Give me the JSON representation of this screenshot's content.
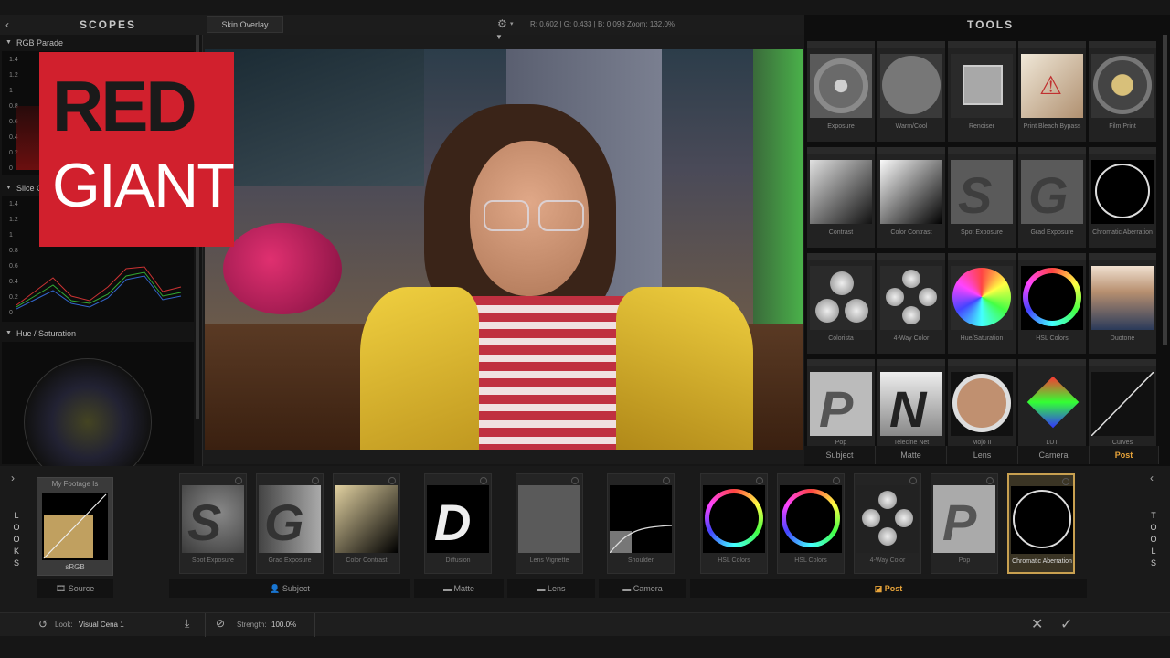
{
  "scopes": {
    "title": "SCOPES",
    "sections": [
      {
        "label": "RGB Parade"
      },
      {
        "label": "Slice Graph"
      },
      {
        "label": "Hue / Saturation"
      }
    ],
    "ticks": [
      "1.4",
      "1.2",
      "1",
      "0.8",
      "0.6",
      "0.4",
      "0.2",
      "0"
    ]
  },
  "logo": {
    "line1": "RED",
    "line2": "GIANT"
  },
  "viewer": {
    "skin_overlay": "Skin Overlay",
    "readout": "R: 0.602 | G: 0.433 | B: 0.098    Zoom: 132.0%"
  },
  "tools": {
    "title": "TOOLS",
    "items": [
      {
        "label": "Exposure"
      },
      {
        "label": "Warm/Cool"
      },
      {
        "label": "Renoiser"
      },
      {
        "label": "Print Bleach Bypass"
      },
      {
        "label": "Film Print"
      },
      {
        "label": "Contrast"
      },
      {
        "label": "Color Contrast"
      },
      {
        "label": "Spot Exposure"
      },
      {
        "label": "Grad Exposure"
      },
      {
        "label": "Chromatic Aberration"
      },
      {
        "label": "Colorista"
      },
      {
        "label": "4-Way Color"
      },
      {
        "label": "Hue/Saturation"
      },
      {
        "label": "HSL Colors"
      },
      {
        "label": "Duotone"
      },
      {
        "label": "Pop"
      },
      {
        "label": "Telecine Net"
      },
      {
        "label": "Mojo II"
      },
      {
        "label": "LUT"
      },
      {
        "label": "Curves"
      }
    ],
    "tabs": [
      "Subject",
      "Matte",
      "Lens",
      "Camera",
      "Post"
    ],
    "active_tab": "Post",
    "accent": "#e8a43a"
  },
  "looks": {
    "side_label": "LOOKS",
    "source": {
      "title": "My Footage Is",
      "value": "sRGB",
      "label": "Source"
    },
    "cards": [
      {
        "label": "Spot Exposure"
      },
      {
        "label": "Grad Exposure"
      },
      {
        "label": "Color Contrast"
      },
      {
        "label": "Diffusion"
      },
      {
        "label": "Lens Vignette"
      },
      {
        "label": "Shoulder"
      },
      {
        "label": "HSL Colors"
      },
      {
        "label": "HSL Colors"
      },
      {
        "label": "4-Way Color"
      },
      {
        "label": "Pop"
      },
      {
        "label": "Chromatic Aberration"
      }
    ],
    "groups": [
      "Subject",
      "Matte",
      "Lens",
      "Camera",
      "Post"
    ]
  },
  "side_tools_label": "TOOLS",
  "status": {
    "look_label": "Look:",
    "look_value": "Visual Cena 1",
    "strength_label": "Strength:",
    "strength_value": "100.0%"
  }
}
